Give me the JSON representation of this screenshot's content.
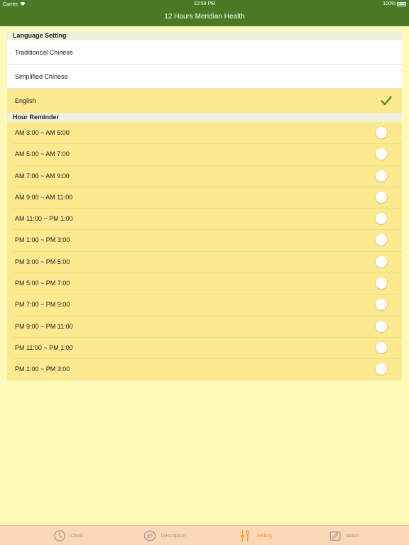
{
  "status_bar": {
    "carrier": "Carrier",
    "time": "10:59 PM",
    "battery": "100%"
  },
  "nav": {
    "title": "12 Hours Meridian Health"
  },
  "language_section": {
    "header": "Language Setting",
    "options": [
      {
        "label": "Traditioncal Chinese",
        "selected": false
      },
      {
        "label": "Simplified Chinese",
        "selected": false
      },
      {
        "label": "English",
        "selected": true
      }
    ]
  },
  "reminder_section": {
    "header": "Hour Reminder",
    "items": [
      {
        "label": "AM 3:00 ~ AM 5:00",
        "on": false
      },
      {
        "label": "AM 5:00 ~ AM 7:00",
        "on": false
      },
      {
        "label": "AM 7:00 ~ AM 9:00",
        "on": false
      },
      {
        "label": "AM 9:00 ~ AM 11:00",
        "on": false
      },
      {
        "label": "AM 11:00 ~ PM 1:00",
        "on": false
      },
      {
        "label": "PM 1:00 ~ PM 3:00",
        "on": false
      },
      {
        "label": "PM 3:00 ~ PM 5:00",
        "on": false
      },
      {
        "label": "PM 5:00 ~ PM 7:00",
        "on": false
      },
      {
        "label": "PM 7:00 ~ PM 9:00",
        "on": false
      },
      {
        "label": "PM 9:00 ~ PM 11:00",
        "on": false
      },
      {
        "label": "PM 11:00 ~ PM 1:00",
        "on": false
      },
      {
        "label": "PM 1:00 ~ PM 3:00",
        "on": false
      }
    ]
  },
  "tabs": [
    {
      "label": "Clock",
      "icon": "clock-icon",
      "active": false
    },
    {
      "label": "Description",
      "icon": "description-icon",
      "active": false
    },
    {
      "label": "Setting",
      "icon": "setting-icon",
      "active": true
    },
    {
      "label": "About",
      "icon": "about-icon",
      "active": false
    }
  ],
  "colors": {
    "nav_green": "#4a7a24",
    "page_bg": "#fdf9b8",
    "row_yellow": "#fde98f",
    "tab_bar_bg": "#fbd8b8",
    "tab_active": "#f29b1f",
    "tab_inactive": "#a59b90",
    "check_green": "#5a8a2a"
  }
}
